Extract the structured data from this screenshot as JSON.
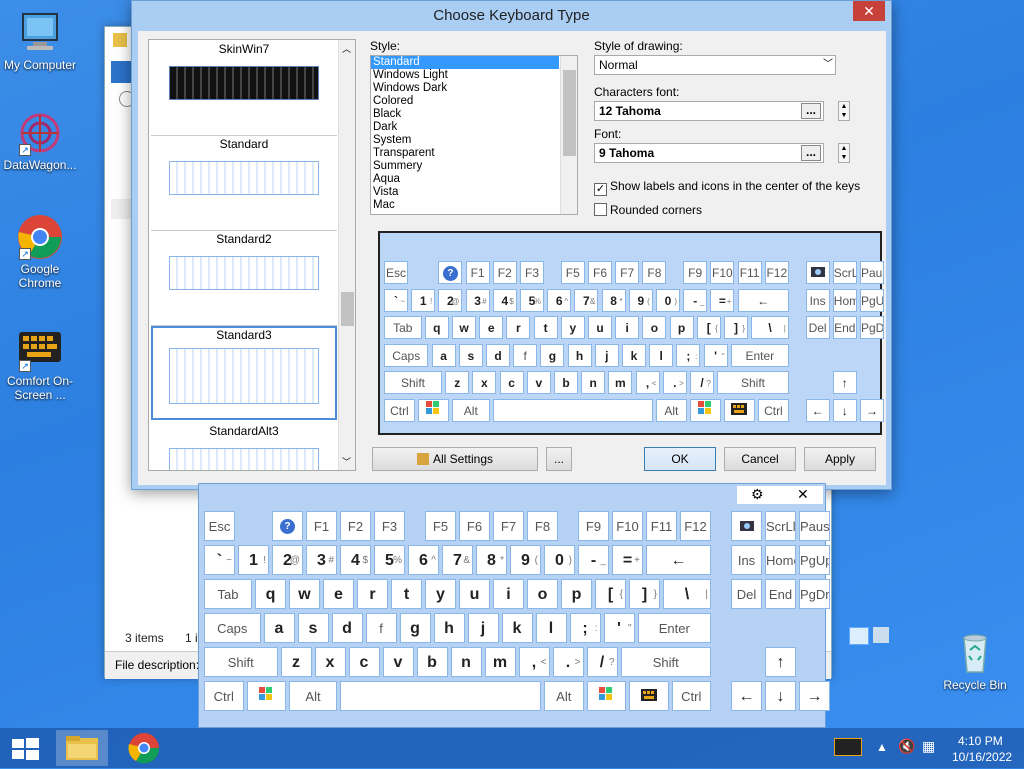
{
  "desktop": {
    "icons": [
      {
        "label": "My Computer"
      },
      {
        "label": "DataWagon..."
      },
      {
        "label": "Google Chrome"
      },
      {
        "label": "Comfort On-Screen ..."
      },
      {
        "label": "Recycle Bin"
      }
    ]
  },
  "explorer": {
    "items_count": "3 items",
    "items_partial": "1 ite",
    "file_description": "File description: C",
    "computer_partial": "mputer"
  },
  "dialog": {
    "title": "Choose Keyboard Type",
    "close": "✕",
    "thumbnails": [
      "SkinWin7",
      "Standard",
      "Standard2",
      "Standard3",
      "StandardAlt3"
    ],
    "style_label": "Style:",
    "styles": [
      "Standard",
      "Windows Light",
      "Windows Dark",
      "Colored",
      "Black",
      "Dark",
      "System",
      "Transparent",
      "Summery",
      "Aqua",
      "Vista",
      "Mac"
    ],
    "style_of_drawing_label": "Style of drawing:",
    "style_of_drawing_value": "Normal",
    "characters_font_label": "Characters font:",
    "characters_font_value": "12 Tahoma",
    "font_label": "Font:",
    "font_value": "9 Tahoma",
    "show_labels": "Show labels and icons in the center of the keys",
    "rounded_corners": "Rounded corners",
    "all_settings": "All Settings",
    "more": "...",
    "ok": "OK",
    "cancel": "Cancel",
    "apply": "Apply"
  },
  "keys": {
    "esc": "Esc",
    "f1": "F1",
    "f2": "F2",
    "f3": "F3",
    "f4": "F4",
    "f5": "F5",
    "f6": "F6",
    "f7": "F7",
    "f8": "F8",
    "f9": "F9",
    "f10": "F10",
    "f11": "F11",
    "f12": "F12",
    "scrl": "ScrLl",
    "paus": "Paus",
    "grave": "`",
    "grave_s": "~",
    "n1": "1",
    "n1_s": "!",
    "n2": "2",
    "n2_s": "@",
    "n3": "3",
    "n3_s": "#",
    "n4": "4",
    "n4_s": "$",
    "n5": "5",
    "n5_s": "%",
    "n6": "6",
    "n6_s": "^",
    "n7": "7",
    "n7_s": "&",
    "n8": "8",
    "n8_s": "*",
    "n9": "9",
    "n9_s": "(",
    "n0": "0",
    "n0_s": ")",
    "minus": "-",
    "minus_s": "_",
    "equal": "=",
    "equal_s": "+",
    "backspace": "←",
    "ins": "Ins",
    "home": "Hom",
    "pgup": "PgUp",
    "tab": "Tab",
    "q": "q",
    "w": "w",
    "e": "e",
    "r": "r",
    "t": "t",
    "y": "y",
    "u": "u",
    "i": "i",
    "o": "o",
    "p": "p",
    "lbr": "[",
    "lbr_s": "{",
    "rbr": "]",
    "rbr_s": "}",
    "bslash": "\\",
    "bslash_s": "|",
    "del": "Del",
    "end": "End",
    "pgdn": "PgDn",
    "caps": "Caps",
    "a": "a",
    "s": "s",
    "d": "d",
    "f": "f",
    "g": "g",
    "h": "h",
    "j": "j",
    "k": "k",
    "l": "l",
    "semi": ";",
    "semi_s": ":",
    "quote": "'",
    "quote_s": "\"",
    "enter": "Enter",
    "shift": "Shift",
    "z": "z",
    "x": "x",
    "c": "c",
    "v": "v",
    "b": "b",
    "n": "n",
    "m": "m",
    "comma": ",",
    "comma_s": "<",
    "period": ".",
    "period_s": ">",
    "slash": "/",
    "slash_s": "?",
    "up": "↑",
    "ctrl": "Ctrl",
    "alt": "Alt",
    "left": "←",
    "down": "↓",
    "right": "→",
    "help": "?"
  },
  "osk": {
    "gear": "⚙",
    "close": "✕",
    "home": "Home",
    "pgdn": "PgDn"
  },
  "taskbar": {
    "time": "4:10 PM",
    "date": "10/16/2022"
  }
}
